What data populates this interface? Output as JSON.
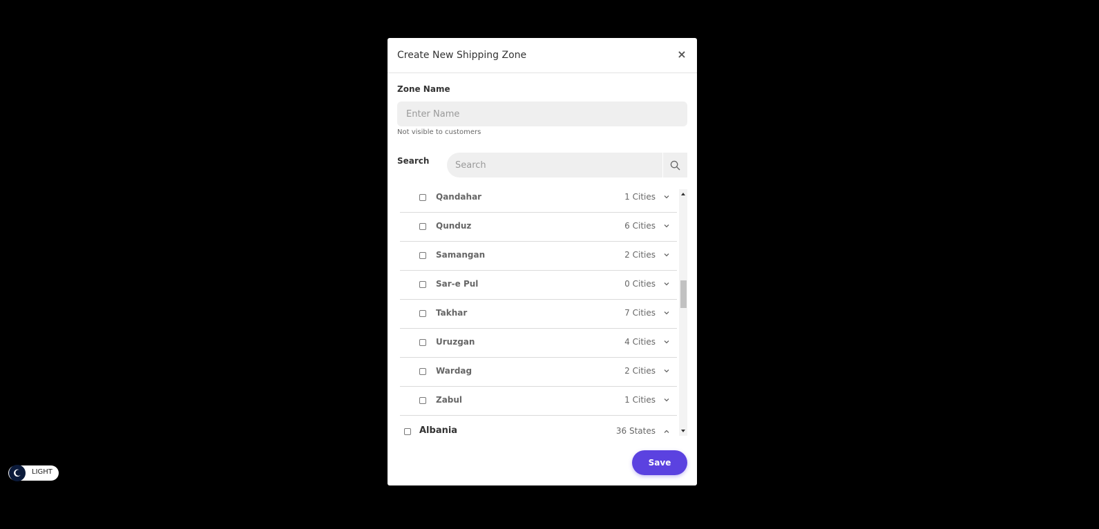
{
  "modal": {
    "title": "Create New Shipping Zone",
    "close_label": "×",
    "zone_name_label": "Zone Name",
    "zone_name_placeholder": "Enter Name",
    "zone_name_hint": "Not visible to customers",
    "search_label": "Search",
    "search_placeholder": "Search",
    "save_label": "Save"
  },
  "states": [
    {
      "name": "Qandahar",
      "count": "1 Cities"
    },
    {
      "name": "Qunduz",
      "count": "6 Cities"
    },
    {
      "name": "Samangan",
      "count": "2 Cities"
    },
    {
      "name": "Sar-e Pul",
      "count": "0 Cities"
    },
    {
      "name": "Takhar",
      "count": "7 Cities"
    },
    {
      "name": "Uruzgan",
      "count": "4 Cities"
    },
    {
      "name": "Wardag",
      "count": "2 Cities"
    },
    {
      "name": "Zabul",
      "count": "1 Cities"
    }
  ],
  "country": {
    "name": "Albania",
    "count": "36 States"
  },
  "theme_toggle": {
    "label": "LIGHT"
  },
  "colors": {
    "accent": "#5b42e0",
    "backdrop": "#000000",
    "toggle_knob": "#0b1a3a"
  },
  "icons": {
    "search": "search-icon",
    "close": "close-icon",
    "expand": "chevron-down-icon",
    "collapse": "chevron-up-icon",
    "theme": "moon-icon"
  }
}
